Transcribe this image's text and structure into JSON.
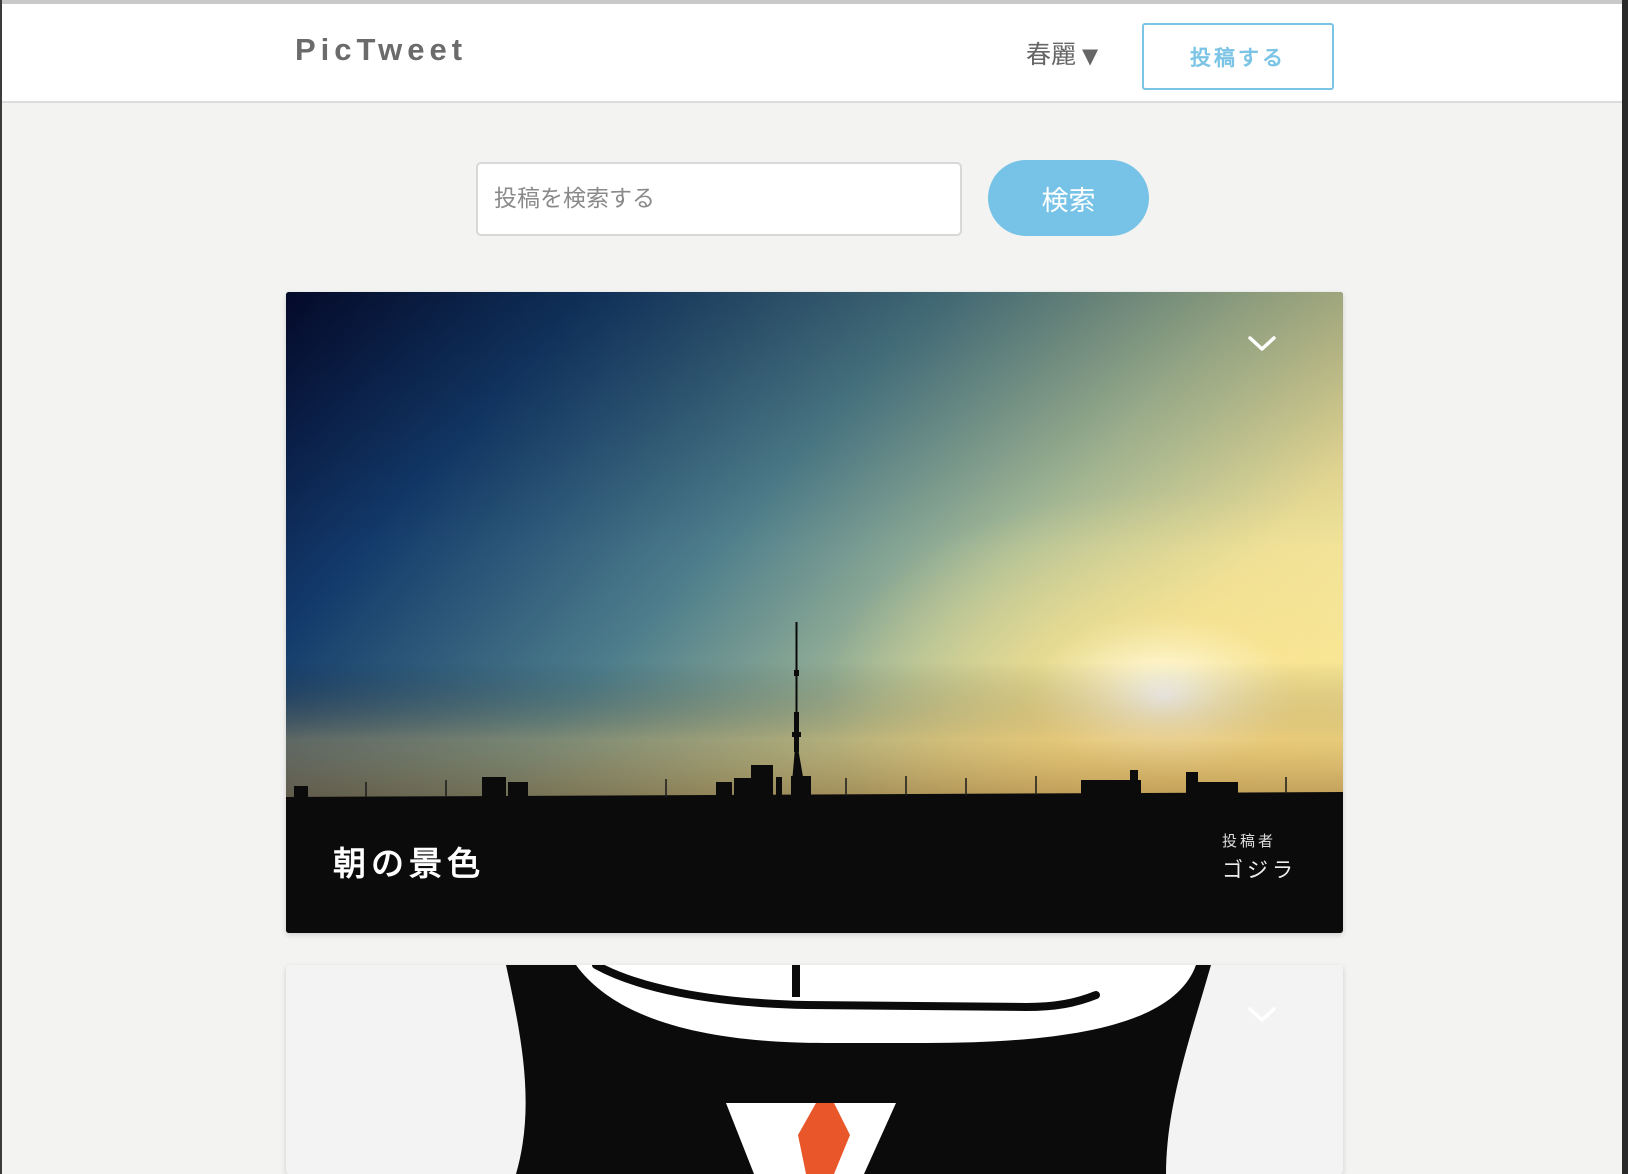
{
  "header": {
    "logo": "PicTweet",
    "user_name": "春麗",
    "user_caret": "▼",
    "post_button_label": "投稿する"
  },
  "search": {
    "placeholder": "投稿を検索する",
    "value": "",
    "button_label": "検索"
  },
  "posts": [
    {
      "title": "朝の景色",
      "author_label": "投稿者",
      "author_name": "ゴジラ",
      "image": "sunrise-skyline-with-tower-silhouette",
      "menu_icon": "chevron-down-icon"
    },
    {
      "title": "",
      "image": "cartoon-penguin-with-red-tie",
      "menu_icon": "chevron-down-icon"
    }
  ],
  "colors": {
    "accent": "#77c3e7",
    "page_background": "#f3f3f2",
    "header_background": "#ffffff",
    "tie_orange": "#e8562a"
  }
}
